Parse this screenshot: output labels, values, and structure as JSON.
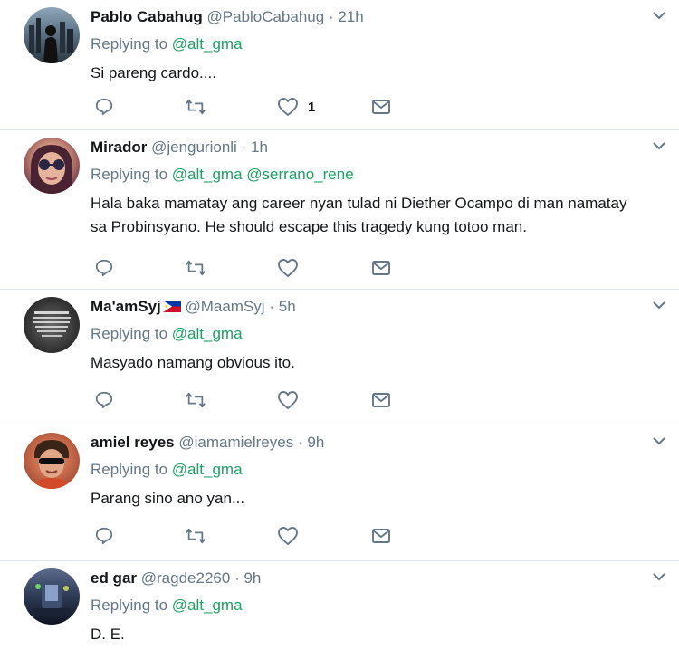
{
  "tweets": [
    {
      "name": "Pablo Cabahug",
      "handle": "@PabloCabahug",
      "time": "21h",
      "replying_prefix": "Replying to",
      "mentions": [
        "@alt_gma"
      ],
      "text": "Si pareng cardo....",
      "likes": "1"
    },
    {
      "name": "Mirador",
      "handle": "@jengurionli",
      "time": "1h",
      "replying_prefix": "Replying to",
      "mentions": [
        "@alt_gma",
        "@serrano_rene"
      ],
      "text": "Hala baka mamatay ang career nyan tulad ni Diether Ocampo di man namatay sa Probinsyano. He should escape this tragedy kung totoo man.",
      "likes": ""
    },
    {
      "name": "Ma'amSyj",
      "handle": "@MaamSyj",
      "time": "5h",
      "replying_prefix": "Replying to",
      "mentions": [
        "@alt_gma"
      ],
      "text": "Masyado namang obvious ito.",
      "likes": ""
    },
    {
      "name": "amiel reyes",
      "handle": "@iamamielreyes",
      "time": "9h",
      "replying_prefix": "Replying to",
      "mentions": [
        "@alt_gma"
      ],
      "text": "Parang sino ano yan...",
      "likes": ""
    },
    {
      "name": "ed gar",
      "handle": "@ragde2260",
      "time": "9h",
      "replying_prefix": "Replying to",
      "mentions": [
        "@alt_gma"
      ],
      "text": "D. E.",
      "likes": ""
    }
  ],
  "separator": "·",
  "colors": {
    "mention": "#1da163",
    "muted": "#657786",
    "icon": "#657786",
    "divider": "#e1e8ed"
  },
  "icons": {
    "reply": "reply-icon",
    "retweet": "retweet-icon",
    "like": "heart-icon",
    "dm": "envelope-icon",
    "menu": "chevron-down-icon",
    "flag": "philippines-flag-icon"
  }
}
